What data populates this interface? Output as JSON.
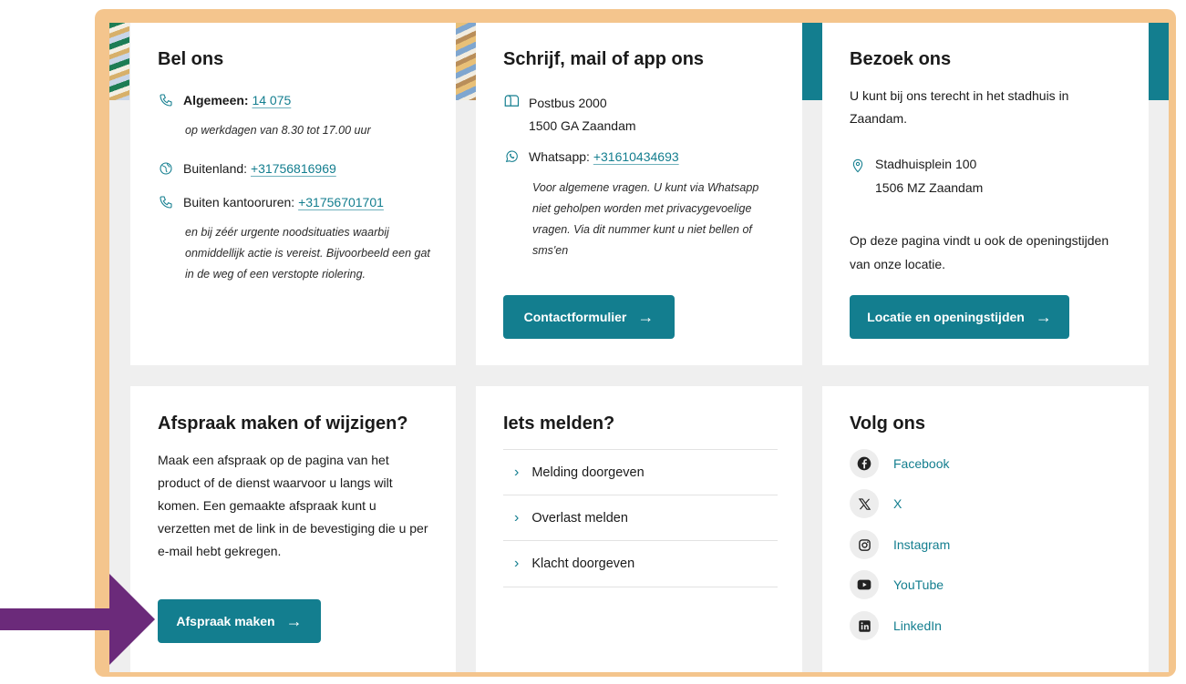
{
  "bel_ons": {
    "title": "Bel ons",
    "algemeen_label": "Algemeen:",
    "algemeen_number": "14 075",
    "algemeen_note": "op werkdagen van 8.30 tot 17.00 uur",
    "buitenland_label": "Buitenland:",
    "buitenland_number": "+31756816969",
    "kantoor_label": "Buiten kantooruren:",
    "kantoor_number": "+31756701701",
    "kantoor_note": "en bij zéér urgente noodsituaties waarbij onmiddellijk actie is vereist. Bijvoorbeeld een gat in de weg of een verstopte riolering."
  },
  "schrijf": {
    "title": "Schrijf, mail of app ons",
    "postbus_line1": "Postbus 2000",
    "postbus_line2": "1500 GA Zaandam",
    "whatsapp_label": "Whatsapp:",
    "whatsapp_number": "+31610434693",
    "whatsapp_note": "Voor algemene vragen. U kunt via Whatsapp niet geholpen worden met privacygevoelige vragen. Via dit nummer kunt u niet bellen of sms'en",
    "button_label": "Contactformulier"
  },
  "bezoek": {
    "title": "Bezoek ons",
    "intro": "U kunt bij ons terecht in het stadhuis in Zaandam.",
    "address_line1": "Stadhuisplein 100",
    "address_line2": "1506 MZ Zaandam",
    "openingstijden_text": "Op deze pagina vindt u ook de openingstijden van onze locatie.",
    "button_label": "Locatie en openingstijden"
  },
  "afspraak": {
    "title": "Afspraak maken of wijzigen?",
    "text": "Maak een afspraak op de pagina van het product of de dienst waarvoor u langs wilt komen. Een gemaakte afspraak kunt u verzetten met de link in de bevestiging die u per e-mail hebt gekregen.",
    "button_label": "Afspraak maken"
  },
  "melden": {
    "title": "Iets melden?",
    "items": [
      "Melding doorgeven",
      "Overlast melden",
      "Klacht doorgeven"
    ]
  },
  "volg": {
    "title": "Volg ons",
    "items": [
      {
        "label": "Facebook",
        "icon": "facebook-icon"
      },
      {
        "label": "X",
        "icon": "x-icon"
      },
      {
        "label": "Instagram",
        "icon": "instagram-icon"
      },
      {
        "label": "YouTube",
        "icon": "youtube-icon"
      },
      {
        "label": "LinkedIn",
        "icon": "linkedin-icon"
      }
    ]
  },
  "colors": {
    "accent": "#137e8f",
    "frame": "#f4c58d",
    "pointer_arrow": "#6b2a7a"
  },
  "arrow_glyph": "→",
  "chevron_glyph": "›"
}
